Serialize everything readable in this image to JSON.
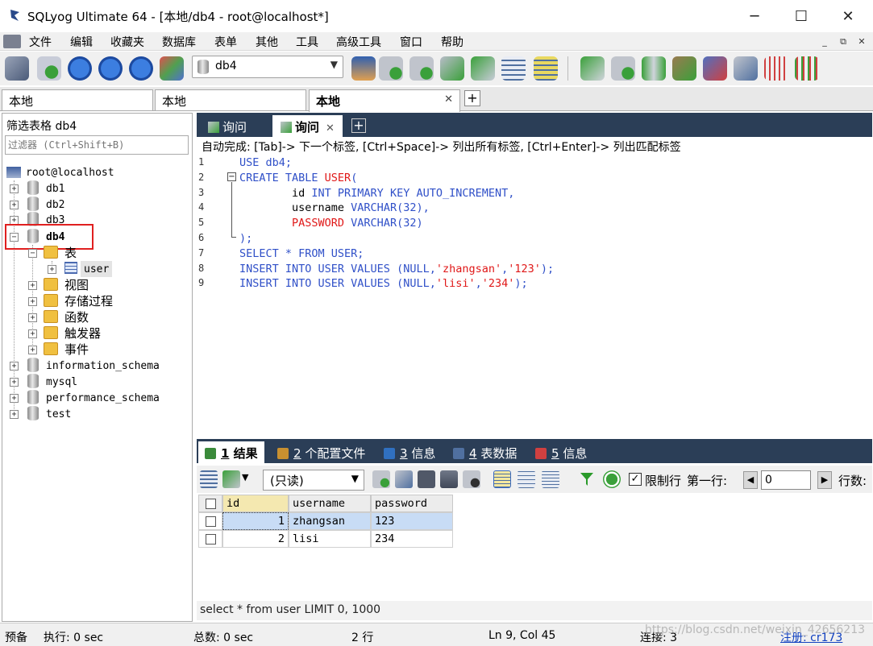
{
  "window": {
    "title": "SQLyog Ultimate 64 - [本地/db4 - root@localhost*]",
    "minimize": "─",
    "maximize": "☐",
    "close": "✕"
  },
  "menu": [
    "文件",
    "编辑",
    "收藏夹",
    "数据库",
    "表单",
    "其他",
    "工具",
    "高级工具",
    "窗口",
    "帮助"
  ],
  "mdi_controls": [
    "_",
    "⧉",
    "✕"
  ],
  "toolbar": {
    "db_selected": "db4"
  },
  "connection_tabs": [
    {
      "label": "本地",
      "active": false
    },
    {
      "label": "本地",
      "active": false
    },
    {
      "label": "本地",
      "active": true
    }
  ],
  "connection_add": "+",
  "object_browser": {
    "filter_label": "筛选表格 db4",
    "filter_placeholder": "过滤器 (Ctrl+Shift+B)",
    "root": "root@localhost",
    "databases_before": [
      "db1",
      "db2",
      "db3"
    ],
    "active_db": "db4",
    "active_db_children": {
      "tables_folder": "表",
      "table": "user",
      "folders": [
        "视图",
        "存储过程",
        "函数",
        "触发器",
        "事件"
      ]
    },
    "databases_after": [
      "information_schema",
      "mysql",
      "performance_schema",
      "test"
    ]
  },
  "query_tabs": [
    {
      "label": "询问",
      "active": false
    },
    {
      "label": "询问",
      "active": true
    }
  ],
  "query_add": "+",
  "autocomplete_hint": "自动完成: [Tab]-> 下一个标签, [Ctrl+Space]-> 列出所有标签, [Ctrl+Enter]-> 列出匹配标签",
  "editor": {
    "line_numbers": [
      "1",
      "2",
      "3",
      "4",
      "5",
      "6",
      "7",
      "8",
      "9"
    ],
    "lines": [
      [
        {
          "t": "USE ",
          "c": "kw"
        },
        {
          "t": "db4;",
          "c": "kw"
        }
      ],
      [
        {
          "t": "CREATE TABLE ",
          "c": "kw"
        },
        {
          "t": "USER",
          "c": "str"
        },
        {
          "t": "(",
          "c": "kw"
        }
      ],
      [
        {
          "t": "        id ",
          "c": "pl"
        },
        {
          "t": "INT PRIMARY KEY AUTO_INCREMENT,",
          "c": "kw"
        }
      ],
      [
        {
          "t": "        username ",
          "c": "pl"
        },
        {
          "t": "VARCHAR(32),",
          "c": "kw"
        }
      ],
      [
        {
          "t": "        PASSWORD ",
          "c": "str"
        },
        {
          "t": "VARCHAR(32)",
          "c": "kw"
        }
      ],
      [
        {
          "t": ");",
          "c": "kw"
        }
      ],
      [
        {
          "t": "SELECT * FROM USER;",
          "c": "kw"
        }
      ],
      [
        {
          "t": "INSERT INTO USER VALUES (NULL,",
          "c": "kw"
        },
        {
          "t": "'zhangsan'",
          "c": "str"
        },
        {
          "t": ",",
          "c": "kw"
        },
        {
          "t": "'123'",
          "c": "str"
        },
        {
          "t": ");",
          "c": "kw"
        }
      ],
      [
        {
          "t": "INSERT INTO USER VALUES (NULL,",
          "c": "kw"
        },
        {
          "t": "'lisi'",
          "c": "str"
        },
        {
          "t": ",",
          "c": "kw"
        },
        {
          "t": "'234'",
          "c": "str"
        },
        {
          "t": ");",
          "c": "kw"
        }
      ]
    ]
  },
  "result_tabs": [
    {
      "num": "1",
      "label": "结果",
      "active": true,
      "icon_color": "#3a8a3a"
    },
    {
      "num": "2",
      "label": "个配置文件",
      "active": false,
      "icon_color": "#c89030"
    },
    {
      "num": "3",
      "label": "信息",
      "active": false,
      "icon_color": "#3070c0"
    },
    {
      "num": "4",
      "label": "表数据",
      "active": false,
      "icon_color": "#5070a0"
    },
    {
      "num": "5",
      "label": "信息",
      "active": false,
      "icon_color": "#d04040"
    }
  ],
  "result_toolbar": {
    "mode": "(只读)",
    "limit_label": "限制行",
    "limit_checked": "✓",
    "first_row_label": "第一行:",
    "first_row_value": "0",
    "rows_label": "行数:"
  },
  "grid": {
    "columns": [
      "id",
      "username",
      "password"
    ],
    "rows": [
      [
        "1",
        "zhangsan",
        "123"
      ],
      [
        "2",
        "lisi",
        "234"
      ]
    ]
  },
  "sql_status": "select * from user LIMIT 0, 1000",
  "statusbar": {
    "ready": "预备",
    "exec": "执行: 0 sec",
    "total": "总数: 0 sec",
    "rows": "2 行",
    "position": "Ln 9, Col 45",
    "connections": "连接: 3",
    "register": "注册: cr173"
  },
  "watermark": "https://blog.csdn.net/weixin_42656213",
  "colors": {
    "tab_bar": "#2b3e57",
    "keyword": "#3050c8",
    "string": "#e01818",
    "highlight_box": "#e02020",
    "selected_cell": "#c8dcf5"
  }
}
